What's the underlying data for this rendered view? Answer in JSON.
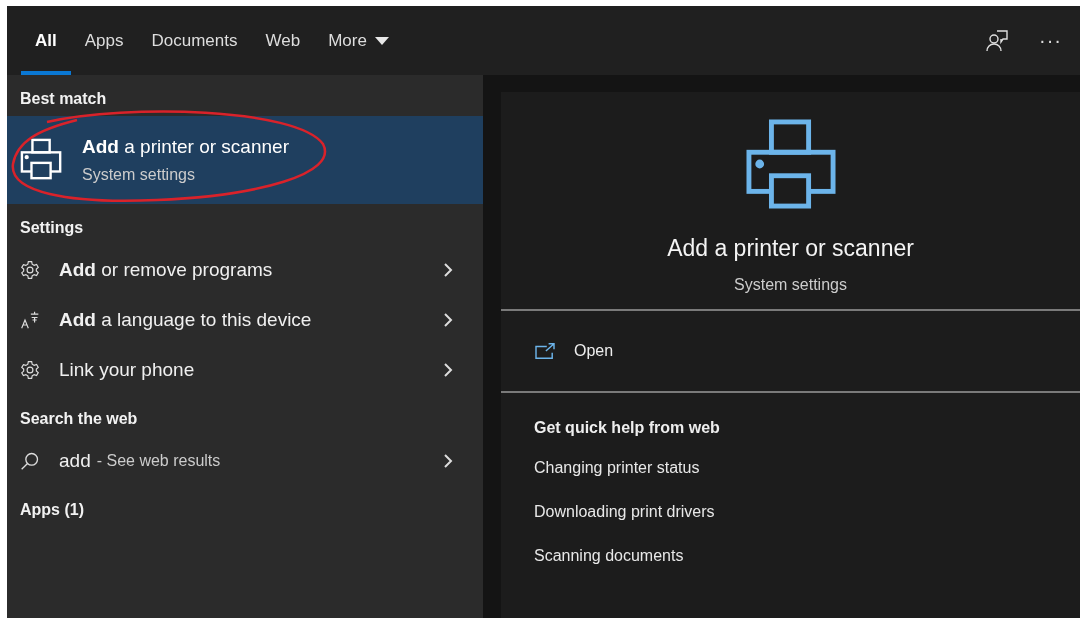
{
  "tabs": [
    {
      "label": "All",
      "selected": true
    },
    {
      "label": "Apps",
      "selected": false
    },
    {
      "label": "Documents",
      "selected": false
    },
    {
      "label": "Web",
      "selected": false
    },
    {
      "label": "More",
      "selected": false,
      "dropdown": true
    }
  ],
  "toolbar": {
    "more_glyph": "···"
  },
  "best_match": {
    "heading": "Best match",
    "item": {
      "title": "**Add** a printer or scanner",
      "subtitle": "System settings",
      "selected": true,
      "circled": true
    }
  },
  "settings": {
    "heading": "Settings",
    "items": [
      {
        "kind": "gear",
        "title": "**Add** or remove programs"
      },
      {
        "kind": "language",
        "title": "**Add** a language to this device"
      },
      {
        "kind": "gear",
        "title": "Link your phone"
      }
    ]
  },
  "web": {
    "heading": "Search the web",
    "query": "add",
    "suffix": "- See web results"
  },
  "apps": {
    "heading": "Apps (1)"
  },
  "preview": {
    "title": "Add a printer or scanner",
    "subtitle": "System settings",
    "action": "Open",
    "help_heading": "Get quick help from web",
    "links": [
      "Changing printer status",
      "Downloading print drivers",
      "Scanning documents"
    ]
  }
}
